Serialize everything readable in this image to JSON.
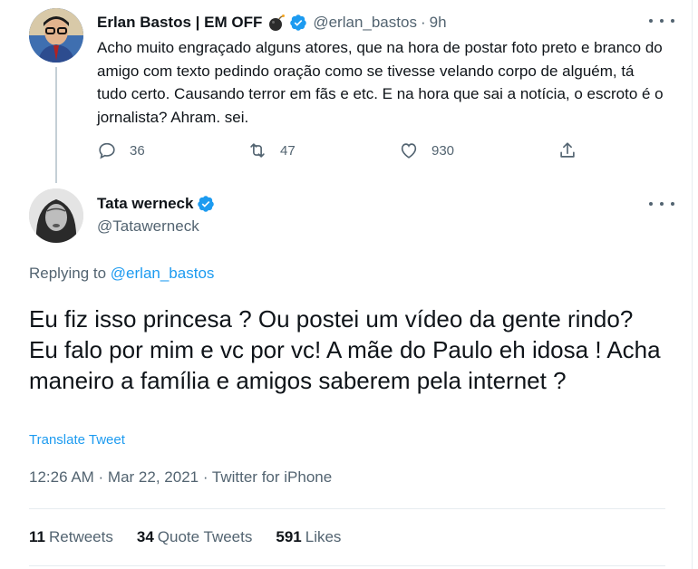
{
  "colors": {
    "accent": "#1d9bf0",
    "muted": "#536471",
    "text": "#0f1419"
  },
  "tweet1": {
    "display_name": "Erlan Bastos | EM OFF",
    "emoji": "bomb-icon",
    "handle": "@erlan_bastos",
    "separator": "·",
    "time": "9h",
    "text": "Acho muito engraçado alguns atores, que na hora de postar foto preto e branco do amigo com texto pedindo oração como se tivesse velando corpo de alguém, tá tudo certo. Causando terror em fãs e etc. E na hora que sai a notícia, o escroto é o jornalista? Ahram. sei.",
    "replies": "36",
    "retweets": "47",
    "likes": "930"
  },
  "tweet2": {
    "display_name": "Tata werneck",
    "handle": "@Tatawerneck",
    "replying_prefix": "Replying to",
    "replying_handle": "@erlan_bastos",
    "text": "Eu fiz isso princesa ? Ou postei um vídeo da gente rindo? Eu falo por mim e vc por vc! A mãe do Paulo eh idosa ! Acha maneiro a família e amigos saberem pela internet ?",
    "translate_label": "Translate Tweet",
    "meta": "12:26 AM · Mar 22, 2021 · Twitter for iPhone",
    "stats": {
      "retweets_count": "11",
      "retweets_label": "Retweets",
      "quotes_count": "34",
      "quotes_label": "Quote Tweets",
      "likes_count": "591",
      "likes_label": "Likes"
    }
  }
}
